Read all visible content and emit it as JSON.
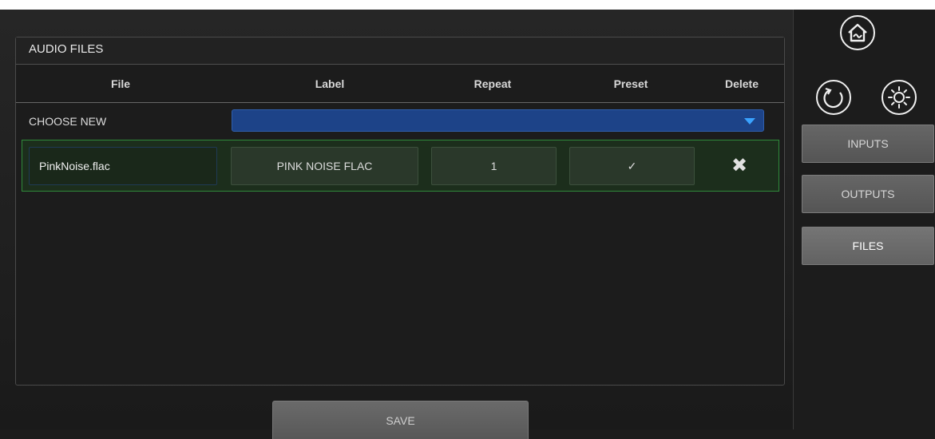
{
  "panel": {
    "title": "AUDIO FILES"
  },
  "columns": {
    "file": "File",
    "label": "Label",
    "repeat": "Repeat",
    "preset": "Preset",
    "delete": "Delete"
  },
  "choose": {
    "label": "CHOOSE NEW",
    "selected": ""
  },
  "files": [
    {
      "file": "PinkNoise.flac",
      "label": "PINK NOISE FLAC",
      "repeat": "1",
      "preset": "✓",
      "delete": "✖"
    }
  ],
  "actions": {
    "save_label": "SAVE"
  },
  "sidebar": {
    "icons": [
      "home-icon",
      "refresh-icon",
      "brightness-icon"
    ],
    "buttons": [
      {
        "label": "INPUTS",
        "active": false
      },
      {
        "label": "OUTPUTS",
        "active": false
      },
      {
        "label": "FILES",
        "active": true
      }
    ]
  },
  "colors": {
    "accent_blue": "#1d4388",
    "row_border": "#2f8a3a",
    "caret": "#3aa3ff"
  }
}
